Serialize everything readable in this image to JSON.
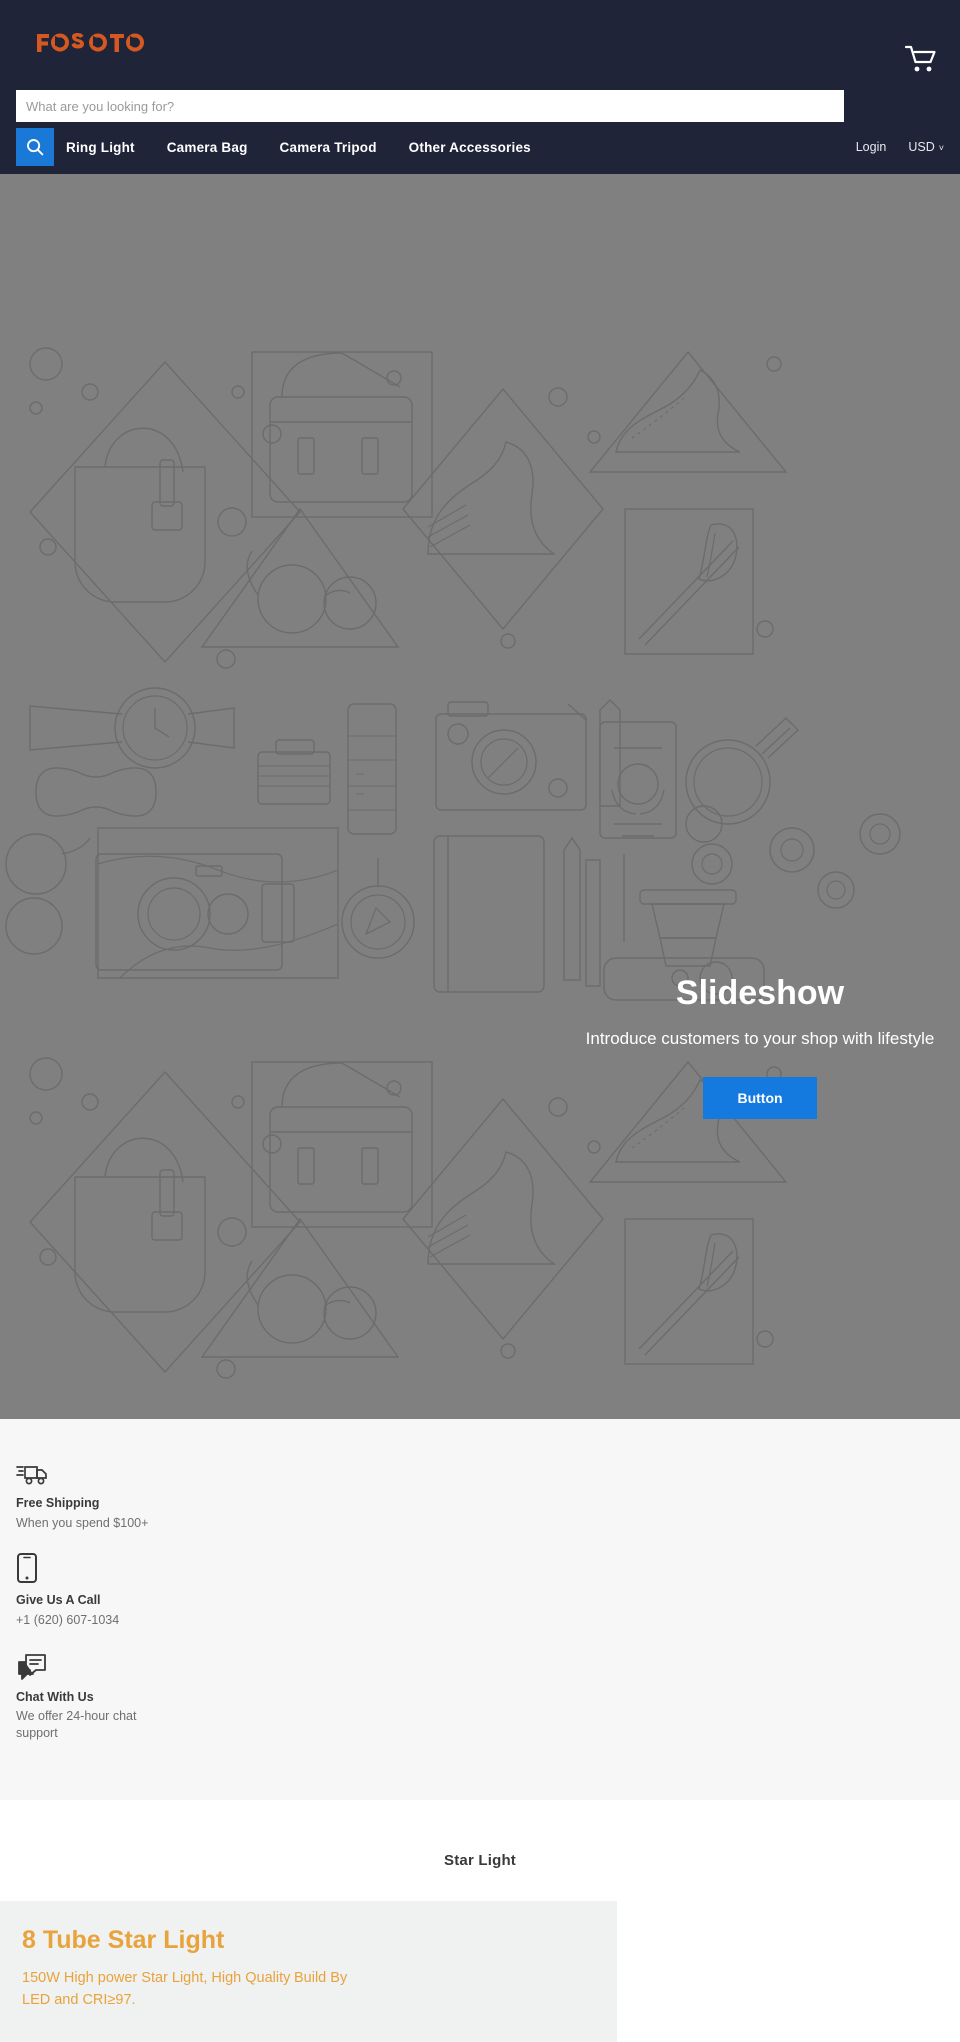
{
  "header": {
    "logo_text": "FOSOTO",
    "logo_color": "#d4581f",
    "cart_icon": "shopping-cart-icon",
    "nav": [
      {
        "label": "Ring Light"
      },
      {
        "label": "Camera Bag"
      },
      {
        "label": "Camera Tripod"
      },
      {
        "label": "Other Accessories"
      }
    ],
    "login_label": "Login",
    "currency_label": "USD",
    "currency_chevron": "˅",
    "background_color": "#1f2439"
  },
  "search": {
    "placeholder": "What are you looking for?",
    "value": "",
    "button_icon": "search-icon",
    "button_color": "#1a78d6"
  },
  "hero": {
    "title": "Slideshow",
    "subtitle": "Introduce customers to your shop with lifestyle",
    "button_label": "Button",
    "button_color": "#157ae0",
    "background_color": "#808080"
  },
  "features": [
    {
      "icon": "delivery-truck-icon",
      "title": "Free Shipping",
      "text": "When you spend $100+"
    },
    {
      "icon": "mobile-phone-icon",
      "title": "Give Us A Call",
      "text": "+1 (620) 607-1034"
    },
    {
      "icon": "chat-bubble-icon",
      "title": "Chat With Us",
      "text": "We offer 24-hour chat support"
    }
  ],
  "collection": {
    "title": "Star Light",
    "promo": {
      "heading": "8 Tube Star Light",
      "description": "150W High power Star Light, High Quality LED and CRI≥97.",
      "aside": "Build By",
      "accent_color": "#e8a33d",
      "background_color": "#f0f1f1"
    }
  }
}
